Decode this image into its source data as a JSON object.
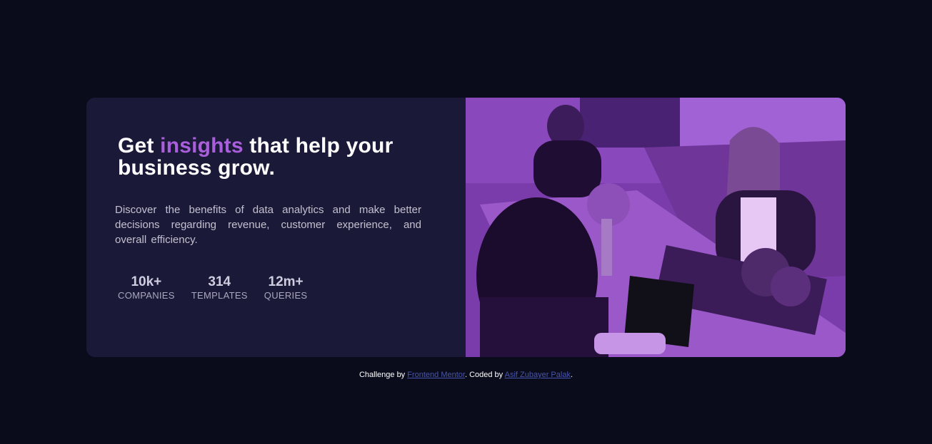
{
  "card": {
    "headline_start": "Get ",
    "headline_accent": "insights",
    "headline_end": " that help your business grow.",
    "description": "Discover the benefits of data analytics and make better decisions regarding revenue, customer experience, and overall efficiency.",
    "stats": [
      {
        "value": "10k+",
        "label": "COMPANIES"
      },
      {
        "value": "314",
        "label": "TEMPLATES"
      },
      {
        "value": "12m+",
        "label": "QUERIES"
      }
    ]
  },
  "attribution": {
    "prefix": "Challenge by ",
    "link1": "Frontend Mentor",
    "middle": ". Coded by ",
    "link2": "Asif Zubayer Palak",
    "suffix": "."
  },
  "colors": {
    "background": "#0a0c1c",
    "card": "#1b1938",
    "accent": "#a95fdc",
    "link": "#4855b0"
  }
}
